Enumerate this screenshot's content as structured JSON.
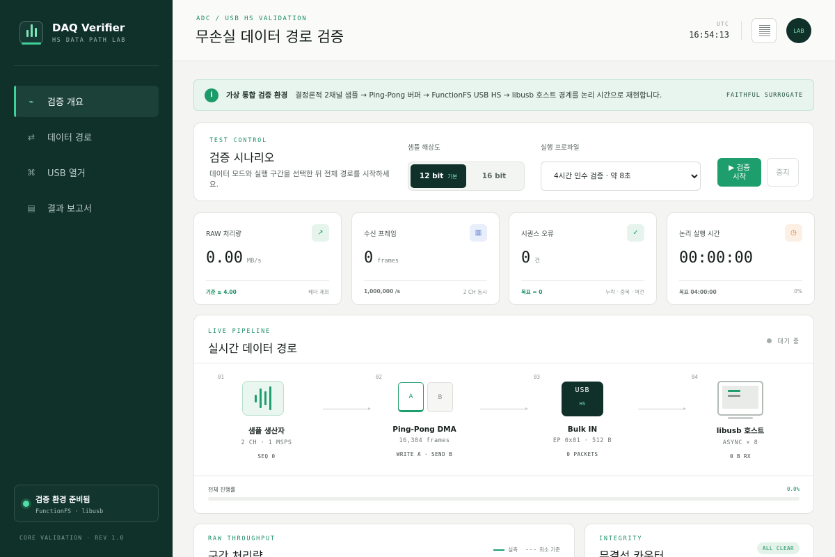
{
  "sidebar": {
    "brand_title": "DAQ Verifier",
    "brand_sub": "HS DATA PATH LAB",
    "items": [
      {
        "label": "검증 개요",
        "icon": "pulse-icon",
        "glyph": "⌁",
        "active": true
      },
      {
        "label": "데이터 경로",
        "icon": "swap-icon",
        "glyph": "⇄",
        "active": false
      },
      {
        "label": "USB 열거",
        "icon": "command-icon",
        "glyph": "⌘",
        "active": false
      },
      {
        "label": "결과 보고서",
        "icon": "report-icon",
        "glyph": "▤",
        "active": false
      }
    ],
    "env_title": "검증 환경 준비됨",
    "env_sub": "FunctionFS · libusb",
    "footer": "CORE VALIDATION · REV 1.0"
  },
  "header": {
    "crumb": "ADC / USB HS VALIDATION",
    "title": "무손실 데이터 경로 검증",
    "utc_label": "UTC",
    "utc_time": "16:54:13",
    "avatar": "LAB"
  },
  "banner": {
    "icon": "i",
    "title": "가상 통합 검증 환경",
    "text": "결정론적 2채널 샘플 → Ping-Pong 버퍼 → FunctionFS USB HS → libusb 호스트 경계를 논리 시간으로 재현합니다.",
    "tag": "FAITHFUL SURROGATE"
  },
  "control": {
    "eyebrow": "TEST CONTROL",
    "title": "검증 시나리오",
    "desc": "데이터 모드와 실행 구간을 선택한 뒤 전체 경로를 시작하세요.",
    "resolution_label": "샘플 해상도",
    "res_12": "12 bit",
    "res_12_tag": "기본",
    "res_16": "16 bit",
    "profile_label": "실행 프로파일",
    "profile_value": "4시간 인수 검증 · 약 8초",
    "start": "▶ 검증 시작",
    "stop": "중지"
  },
  "stats": [
    {
      "label": "RAW 처리량",
      "value": "0.00",
      "unit": "MB/s",
      "foot_l": "기준 ≥ 4.00",
      "foot_r": "헤더 제외",
      "icon": "trend-up-icon",
      "glyph": "↗",
      "color": "#1f9e6d",
      "bg": "#e6f4ed",
      "foot_color": "#1c8f64"
    },
    {
      "label": "수신 프레임",
      "value": "0",
      "unit": "frames",
      "foot_l": "1,000,000 /s",
      "foot_r": "2 CH 동시",
      "icon": "frames-icon",
      "glyph": "▥",
      "color": "#4a6fd0",
      "bg": "#e9eefb",
      "foot_color": "#6b7570"
    },
    {
      "label": "시퀀스 오류",
      "value": "0",
      "unit": "건",
      "foot_l": "목표 = 0",
      "foot_r": "누락 · 중복 · 역전",
      "icon": "check-icon",
      "glyph": "✓",
      "color": "#1f9e6d",
      "bg": "#e6f4ed",
      "foot_color": "#1c8f64"
    },
    {
      "label": "논리 실행 시간",
      "value": "00:00:00",
      "unit": "",
      "foot_l": "목표 04:00:00",
      "foot_r": "0%",
      "icon": "clock-icon",
      "glyph": "◷",
      "color": "#e07b2a",
      "bg": "#fcefe3",
      "foot_color": "#6b7570"
    }
  ],
  "pipeline": {
    "eyebrow": "LIVE PIPELINE",
    "title": "실시간 데이터 경로",
    "status": "대기 중",
    "stages": [
      {
        "num": "01",
        "name": "샘플 생산자",
        "sub": "2 CH · 1 MSPS",
        "meta": "SEQ 0"
      },
      {
        "num": "02",
        "name": "Ping-Pong DMA",
        "sub": "16,384 frames",
        "meta": "WRITE A · SEND B",
        "buf_a": "A",
        "buf_b": "B"
      },
      {
        "num": "03",
        "name": "Bulk IN",
        "sub": "EP 0x81 · 512 B",
        "meta": "0 PACKETS",
        "chip": "USB",
        "chip_sub": "HS"
      },
      {
        "num": "04",
        "name": "libusb 호스트",
        "sub": "ASYNC × 8",
        "meta": "0 B RX"
      }
    ],
    "progress_label": "전체 진행률",
    "progress_text": "0.0%",
    "progress": 0
  },
  "throughput": {
    "eyebrow": "RAW THROUGHPUT",
    "title": "구간 처리량",
    "legend_actual": "실측",
    "legend_min": "최소 기준"
  },
  "integrity": {
    "eyebrow": "INTEGRITY",
    "title": "무결성 카운터",
    "badge": "ALL CLEAR"
  }
}
